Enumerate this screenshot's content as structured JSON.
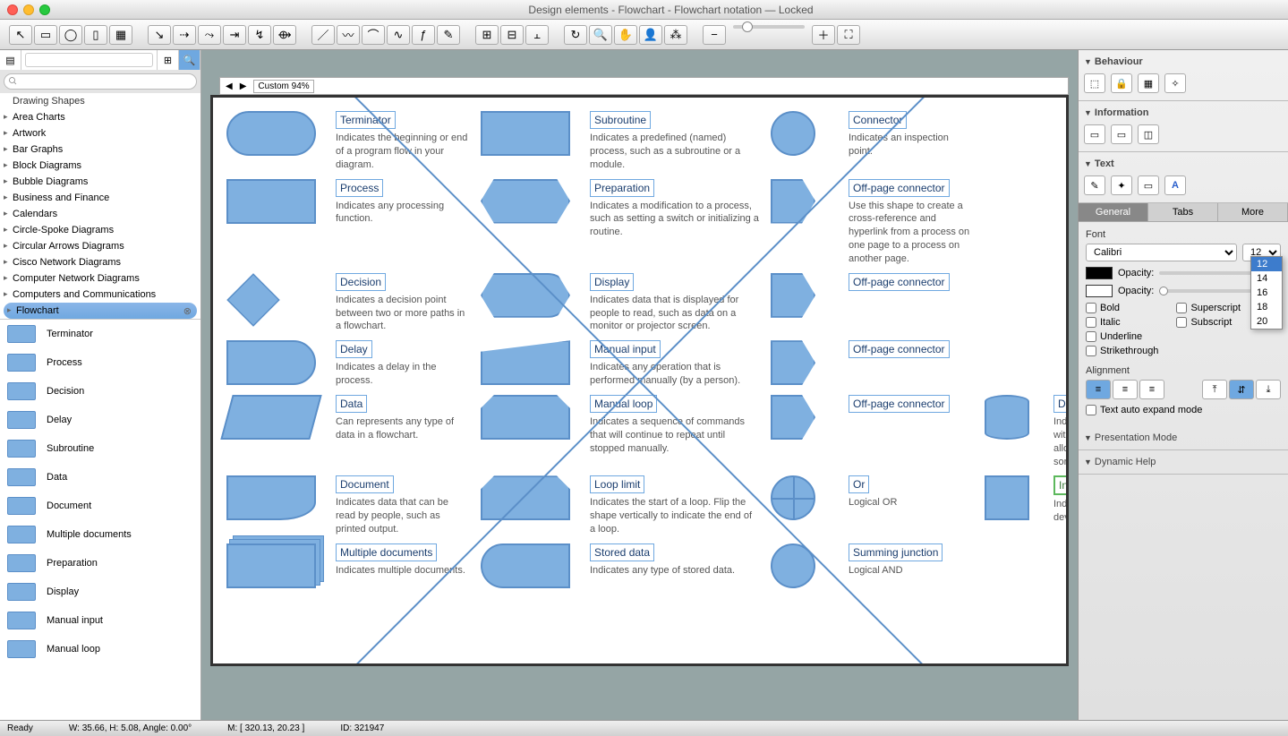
{
  "window": {
    "title": "Design elements - Flowchart - Flowchart notation — Locked"
  },
  "sidebar": {
    "drawing_shapes_header": "Drawing Shapes",
    "categories": [
      "Area Charts",
      "Artwork",
      "Bar Graphs",
      "Block Diagrams",
      "Bubble Diagrams",
      "Business and Finance",
      "Calendars",
      "Circle-Spoke Diagrams",
      "Circular Arrows Diagrams",
      "Cisco Network Diagrams",
      "Computer Network Diagrams",
      "Computers and Communications"
    ],
    "selected": "Flowchart",
    "shapes": [
      "Terminator",
      "Process",
      "Decision",
      "Delay",
      "Subroutine",
      "Data",
      "Document",
      "Multiple documents",
      "Preparation",
      "Display",
      "Manual input",
      "Manual loop"
    ]
  },
  "canvas": {
    "items": [
      {
        "title": "Terminator",
        "desc": "Indicates the beginning or end of a program flow in your diagram."
      },
      {
        "title": "Subroutine",
        "desc": "Indicates a predefined (named) process, such as a subroutine or a module."
      },
      {
        "title": "Connector",
        "desc": "Indicates an inspection point."
      },
      {
        "title": "Process",
        "desc": "Indicates any processing function."
      },
      {
        "title": "Preparation",
        "desc": "Indicates a modification to a process, such as setting a switch or initializing a routine."
      },
      {
        "title": "Off-page connector",
        "desc": "Use this shape to create a cross-reference and hyperlink from a process on one page to a process on another page."
      },
      {
        "title": "Decision",
        "desc": "Indicates a decision point between two or more paths in a flowchart."
      },
      {
        "title": "Display",
        "desc": "Indicates data that is displayed for people to read, such as data on a monitor or projector screen."
      },
      {
        "title": "Off-page connector",
        "desc": ""
      },
      {
        "title": "Delay",
        "desc": "Indicates a delay in the process."
      },
      {
        "title": "Manual input",
        "desc": "Indicates any operation that is performed manually (by a person)."
      },
      {
        "title": "Off-page connector",
        "desc": ""
      },
      {
        "title": "Data",
        "desc": "Can represents any type of data in a flowchart."
      },
      {
        "title": "Manual loop",
        "desc": "Indicates a sequence of commands that will continue to repeat until stopped manually."
      },
      {
        "title": "Off-page connector",
        "desc": ""
      },
      {
        "title": "Document",
        "desc": "Indicates data that can be read by people, such as printed output."
      },
      {
        "title": "Loop limit",
        "desc": "Indicates the start of a loop. Flip the shape vertically to indicate the end of a loop."
      },
      {
        "title": "Or",
        "desc": "Logical OR"
      },
      {
        "title": "Multiple documents",
        "desc": "Indicates multiple documents."
      },
      {
        "title": "Stored data",
        "desc": "Indicates any type of stored data."
      },
      {
        "title": "Summing junction",
        "desc": "Logical AND"
      },
      {
        "title": "Database",
        "desc": "Indicates a list of information with a standard structure that allows for searching and sorting."
      },
      {
        "title": "Internal storage",
        "desc": "Indicates an internal storage device."
      }
    ]
  },
  "right": {
    "behaviour": "Behaviour",
    "information": "Information",
    "text": "Text",
    "tabs": {
      "general": "General",
      "tabs": "Tabs",
      "more": "More"
    },
    "font_label": "Font",
    "font_name": "Calibri",
    "font_size": "12",
    "sizes": [
      "12",
      "14",
      "16",
      "18",
      "20"
    ],
    "opacity": "Opacity:",
    "style": {
      "bold": "Bold",
      "italic": "Italic",
      "underline": "Underline",
      "strike": "Strikethrough",
      "super": "Superscript",
      "sub": "Subscript"
    },
    "alignment": "Alignment",
    "auto": "Text auto expand mode",
    "pres": "Presentation Mode",
    "dyn": "Dynamic Help"
  },
  "ruler": {
    "zoom": "Custom 94%"
  },
  "status": {
    "ready": "Ready",
    "dims": "W: 35.66,  H: 5.08,  Angle: 0.00°",
    "mouse": "M: [ 320.13, 20.23 ]",
    "id": "ID: 321947"
  }
}
